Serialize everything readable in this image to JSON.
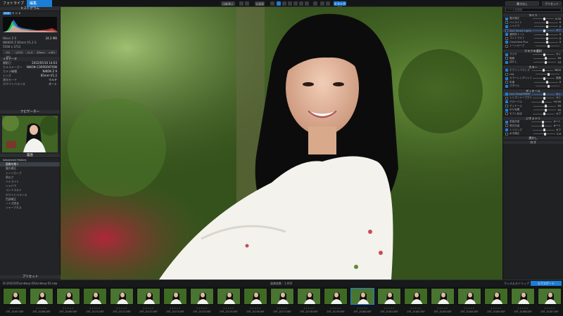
{
  "tabs": {
    "library": "フォトライブラリ",
    "edit": "編集"
  },
  "toolbar": {
    "compare": "比較表示",
    "full": "全画面",
    "export": "書き出し",
    "histogram_sw": "ヒストグラム"
  },
  "left": {
    "histogram_title": "ヒストグラム",
    "hist_modes": [
      "RGB",
      "R",
      "G",
      "B"
    ],
    "exif_title": "撮影情報",
    "file_info": [
      {
        "k": "Nikon Z 9",
        "v": "24.2 MB"
      },
      {
        "k": "NIKKOR Z 85mm f/1.2 S",
        "v": ""
      },
      {
        "k": "5568 x 3712",
        "v": ""
      }
    ],
    "exif_buttons": [
      "ISO 100",
      "1/250",
      "f/1.8",
      "85mm",
      "±0EV"
    ],
    "meta_title": "メタデータ",
    "meta_rows": [
      {
        "k": "撮影日",
        "v": "2022/05/16 14:03"
      },
      {
        "k": "カメラメーカー",
        "v": "NIKON CORPORATION"
      },
      {
        "k": "カメラ機種",
        "v": "NIKON Z 9"
      },
      {
        "k": "レンズ",
        "v": "85mm f/1.2"
      },
      {
        "k": "測光モード",
        "v": "マルチ"
      },
      {
        "k": "ホワイトバランス",
        "v": "オート"
      }
    ],
    "navigator_title": "ナビゲーター",
    "history_title": "履歴",
    "history_items": [
      "Advanced History",
      "画像を開く",
      "露光補正",
      "トーンカーブ",
      "明るさ",
      "ハイライト",
      "シャドウ",
      "コントラスト",
      "ホワイトバランス",
      "色調補正",
      "ノイズ除去",
      "シャープネス"
    ],
    "presets_label": "プリセット"
  },
  "right": {
    "search_placeholder": "ツールを検索",
    "sections": [
      {
        "title": "ライト",
        "items": [
          {
            "label": "露光補正",
            "val": "0.00"
          },
          {
            "label": "ハイライト",
            "val": "0"
          },
          {
            "label": "シャドウ",
            "val": "0"
          },
          {
            "label": "DxO Smart Lighting",
            "val": "オフ"
          },
          {
            "label": "選択的トーン",
            "val": "0"
          },
          {
            "label": "コントラスト",
            "val": "0"
          },
          {
            "label": "ClearView Plus",
            "val": "0"
          },
          {
            "label": "トーンカーブ",
            "val": ""
          }
        ]
      },
      {
        "title": "マスクの選択",
        "items": [
          {
            "label": "マスク",
            "val": "オン"
          },
          {
            "label": "範囲",
            "val": "50"
          },
          {
            "label": "ぼかし",
            "val": "10"
          }
        ]
      },
      {
        "title": "カラー",
        "items": [
          {
            "label": "ホワイトバランス",
            "val": "5600"
          },
          {
            "label": "HSL",
            "val": ""
          },
          {
            "label": "カラーレンダリング",
            "val": "汎用"
          },
          {
            "label": "彩度",
            "val": "0"
          },
          {
            "label": "スタイル",
            "val": ""
          }
        ]
      },
      {
        "title": "ディテール",
        "items": [
          {
            "label": "DxO DeepPRIME",
            "val": "オン"
          },
          {
            "label": "レンズシャープネス",
            "val": "オン"
          },
          {
            "label": "グローバル",
            "val": "+0.00"
          },
          {
            "label": "ディテール",
            "val": "50"
          },
          {
            "label": "ボケ効果",
            "val": "50"
          },
          {
            "label": "モアレ除去",
            "val": "オフ"
          }
        ]
      },
      {
        "title": "ジオメトリ",
        "items": [
          {
            "label": "歪曲収差",
            "val": "オート"
          },
          {
            "label": "周辺光量",
            "val": "オート"
          },
          {
            "label": "トリミング",
            "val": "オフ"
          },
          {
            "label": "水平補正",
            "val": "0.0"
          }
        ]
      },
      {
        "title": "透かし",
        "items": []
      },
      {
        "title": "ロゴ",
        "items": []
      }
    ]
  },
  "filmstrip": {
    "path": "D:\\2022\\05\\Lindsey-03\\Lindsey-03.raw",
    "count": "画像枚数 : 1,002",
    "film_label": "フィルムストリップ",
    "export_btn": "エクスポート",
    "files": [
      "Z9T_10167.NEF",
      "Z9T_10168.NEF",
      "Z9T_10169.NEF",
      "Z9T_10170.NEF",
      "Z9T_10171.NEF",
      "Z9T_10172.NEF",
      "Z9T_10173.NEF",
      "Z9T_10174.NEF",
      "Z9T_10175.NEF",
      "Z9T_10176.NEF",
      "Z9T_10177.NEF",
      "Z9T_10178.NEF",
      "Z9T_10179.NEF",
      "Z9T_10180.NEF",
      "Z9T_10181.NEF",
      "Z9T_10182.NEF",
      "Z9T_10183.NEF",
      "Z9T_10184.NEF",
      "Z9T_10185.NEF",
      "Z9T_10186.NEF",
      "Z9T_10187.NEF"
    ],
    "selected_index": 13
  },
  "colors": {
    "accent": "#1d7ed6",
    "panel": "#232427",
    "foliage": "#3c5a22"
  }
}
